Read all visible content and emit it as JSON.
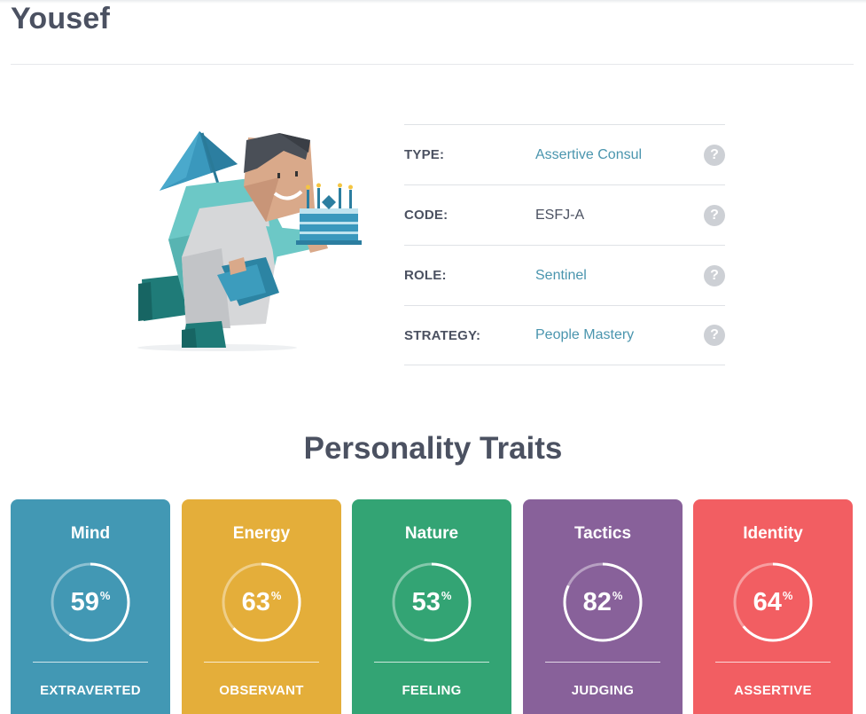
{
  "profile": {
    "name": "Yousef"
  },
  "type_table": {
    "rows": [
      {
        "label": "TYPE:",
        "value": "Assertive Consul",
        "link": true,
        "help": "?"
      },
      {
        "label": "CODE:",
        "value": "ESFJ-A",
        "link": false,
        "help": "?"
      },
      {
        "label": "ROLE:",
        "value": "Sentinel",
        "link": true,
        "help": "?"
      },
      {
        "label": "STRATEGY:",
        "value": "People Mastery",
        "link": true,
        "help": "?"
      }
    ]
  },
  "traits": {
    "title": "Personality Traits",
    "cards": [
      {
        "name": "Mind",
        "percent": 59,
        "unit": "%",
        "trait": "EXTRAVERTED",
        "color": "#4298b4"
      },
      {
        "name": "Energy",
        "percent": 63,
        "unit": "%",
        "trait": "OBSERVANT",
        "color": "#e4ae3a"
      },
      {
        "name": "Nature",
        "percent": 53,
        "unit": "%",
        "trait": "FEELING",
        "color": "#33a474"
      },
      {
        "name": "Tactics",
        "percent": 82,
        "unit": "%",
        "trait": "JUDGING",
        "color": "#88619a"
      },
      {
        "name": "Identity",
        "percent": 64,
        "unit": "%",
        "trait": "ASSERTIVE",
        "color": "#f25e62"
      }
    ]
  },
  "colors": {
    "text": "#4b5161",
    "link": "#4a95ae",
    "help_bg": "#cdd0d5"
  }
}
